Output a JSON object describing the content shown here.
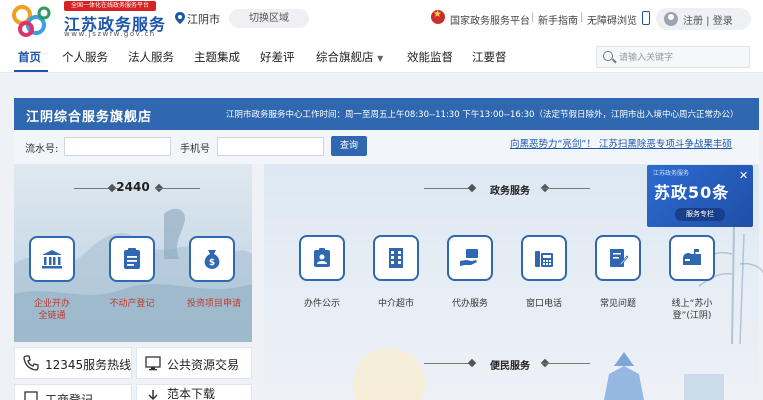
{
  "header": {
    "badge": "全国一体化在线政务服务平台",
    "site_title": "江苏政务服务",
    "site_url": "www.jszwfw.gov.cn",
    "city": "江阴市",
    "switch_area": "切换区域",
    "links": [
      "国家政务服务平台",
      "新手指南",
      "无障碍浏览"
    ],
    "user_links": "注册 | 登录"
  },
  "nav": {
    "items": [
      "首页",
      "个人服务",
      "法人服务",
      "主题集成",
      "好差评",
      "综合旗舰店",
      "效能监督",
      "江要督"
    ],
    "active": "首页",
    "search_placeholder": "请输入关键字"
  },
  "store": {
    "title": "江阴综合服务旗舰店",
    "hours": "江阴市政务服务中心工作时间：周一至周五上午08:30--11:30 下午13:00--16:30（法定节假日除外，江阴市出入境中心周六正常办公）"
  },
  "query": {
    "serial_label": "流水号:",
    "phone_label": "手机号",
    "button": "查询",
    "ticker": "向黑恶势力“亮剑”！ 江苏扫黑除恶专项斗争战果丰硕"
  },
  "left": {
    "count": "2440",
    "services": [
      {
        "label": "企业开办\n全链通",
        "icon": "bank-icon"
      },
      {
        "label": "不动产登记",
        "icon": "document-icon"
      },
      {
        "label": "投资项目申请",
        "icon": "money-bag-icon"
      }
    ],
    "tiles": [
      "12345服务热线",
      "公共资源交易",
      "工商登记",
      "范本下载"
    ]
  },
  "right": {
    "section1": "政务服务",
    "services": [
      "办件公示",
      "中介超市",
      "代办服务",
      "窗口电话",
      "常见问题",
      "线上“苏小\n登”(江阴)"
    ],
    "section2": "便民服务"
  },
  "promo": {
    "head": "江苏政务服务",
    "title": "苏政50条",
    "sub": "服务专栏"
  },
  "colors": {
    "brand": "#2f68b0",
    "accent_red": "#c0392b"
  }
}
